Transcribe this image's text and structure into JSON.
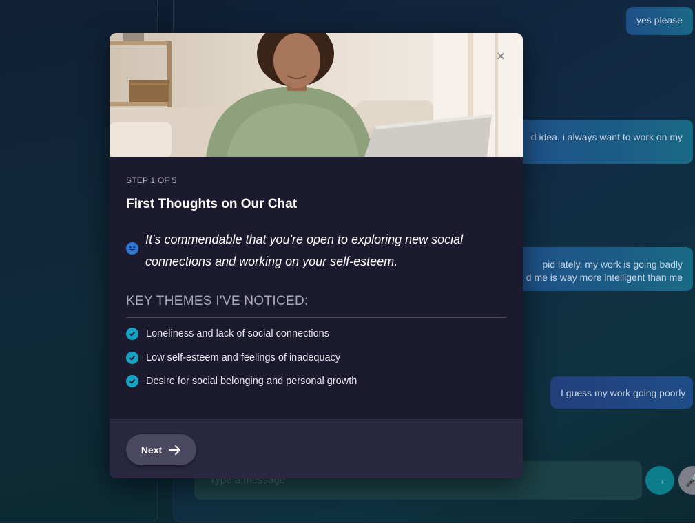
{
  "chat": {
    "messages": [
      {
        "lines": [
          "yes please"
        ]
      },
      {
        "lines": [
          "d idea. i always want to work on my",
          ""
        ]
      },
      {
        "lines": [
          "pid lately. my work is going badly",
          "d me is way more intelligent than me"
        ]
      },
      {
        "lines": [
          "I guess my work going poorly"
        ]
      }
    ],
    "input_placeholder": "Type a message"
  },
  "modal": {
    "step": "STEP 1 OF 5",
    "title": "First Thoughts on Our Chat",
    "quote": "It's commendable that you're open to exploring new social connections and working on your self-esteem.",
    "themes_heading": "KEY THEMES I'VE NOTICED:",
    "themes": [
      "Loneliness and lack of social connections",
      "Low self-esteem and feelings of inadequacy",
      "Desire for social belonging and personal growth"
    ],
    "next_label": "Next",
    "close_symbol": "×"
  },
  "colors": {
    "accent_teal": "#17a3c3",
    "modal_bg": "#1c1a2e",
    "message_blue": "#1f4f88"
  }
}
